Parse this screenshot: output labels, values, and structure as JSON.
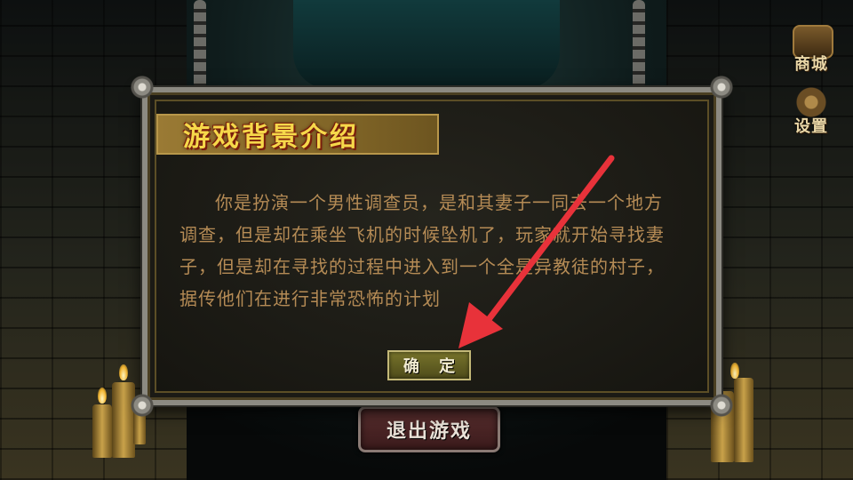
{
  "side_menu": {
    "shop_label": "商城",
    "settings_label": "设置"
  },
  "dialog": {
    "title": "游戏背景介绍",
    "body": "你是扮演一个男性调查员，是和其妻子一同去一个地方调查，但是却在乘坐飞机的时候坠机了，玩家就开始寻找妻子，但是却在寻找的过程中进入到一个全是异教徒的村子，据传他们在进行非常恐怖的计划",
    "confirm_label": "确 定"
  },
  "exit_button_label": "退出游戏",
  "colors": {
    "title_text": "#f6d84a",
    "body_text": "#b58b55",
    "annotation_arrow": "#e8323a"
  }
}
